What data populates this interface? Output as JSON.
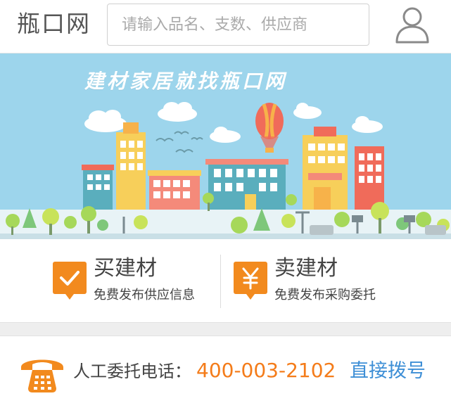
{
  "header": {
    "logo": "瓶口网",
    "search_placeholder": "请输入品名、支数、供应商",
    "user_icon": "user-icon"
  },
  "banner": {
    "title": "建材家居就找瓶口网",
    "sky_color": "#9dd5ec"
  },
  "trade": {
    "buy": {
      "title": "买建材",
      "subtitle": "免费发布供应信息",
      "icon": "check-icon"
    },
    "sell": {
      "title": "卖建材",
      "subtitle": "免费发布采购委托",
      "icon": "yuan-icon"
    },
    "accent": "#f28a1e"
  },
  "contact": {
    "label": "人工委托电话：",
    "number": "400-003-2102",
    "dial_label": "直接拨号",
    "icon": "telephone-icon",
    "number_color": "#f47c1a",
    "link_color": "#3e8fd6"
  }
}
